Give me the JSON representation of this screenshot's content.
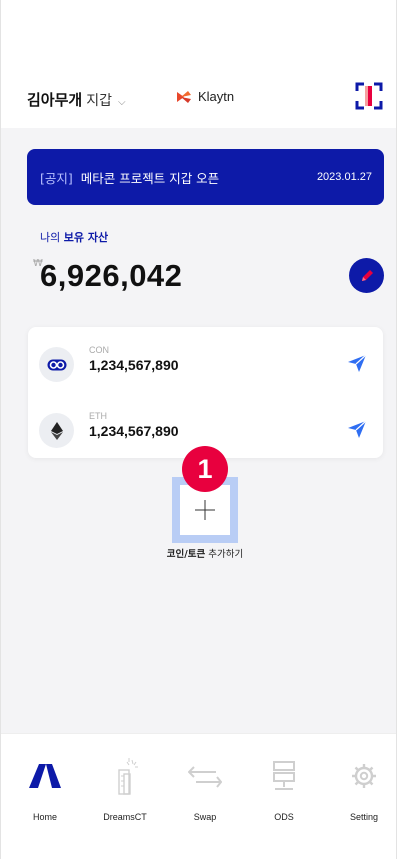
{
  "header": {
    "wallet_owner": "김아무개",
    "wallet_label": "지갑",
    "network": "Klaytn"
  },
  "notice": {
    "tag": "[공지]",
    "text": "메타콘 프로젝트 지갑 오픈",
    "date": "2023.01.27"
  },
  "assets": {
    "label_prefix": "나의",
    "label_strong": "보유 자산",
    "currency": "₩",
    "total": "6,926,042"
  },
  "coins": [
    {
      "symbol": "CON",
      "amount": "1,234,567,890",
      "icon": "con-coin-icon"
    },
    {
      "symbol": "ETH",
      "amount": "1,234,567,890",
      "icon": "ethereum-icon"
    }
  ],
  "add_token": {
    "step": "1",
    "label_strong": "코인/토큰",
    "label_rest": "추가하기"
  },
  "nav": [
    {
      "label": "Home",
      "icon": "home-icon",
      "active": true
    },
    {
      "label": "DreamsCT",
      "icon": "building-icon",
      "active": false
    },
    {
      "label": "Swap",
      "icon": "swap-arrows-icon",
      "active": false
    },
    {
      "label": "ODS",
      "icon": "server-icon",
      "active": false
    },
    {
      "label": "Setting",
      "icon": "gear-icon",
      "active": false
    }
  ],
  "colors": {
    "primary": "#0d1aa8",
    "send": "#2f6ef2",
    "badge": "#e8003e",
    "highlight": "#b9cdf5",
    "klaytn": "#e8472b"
  }
}
